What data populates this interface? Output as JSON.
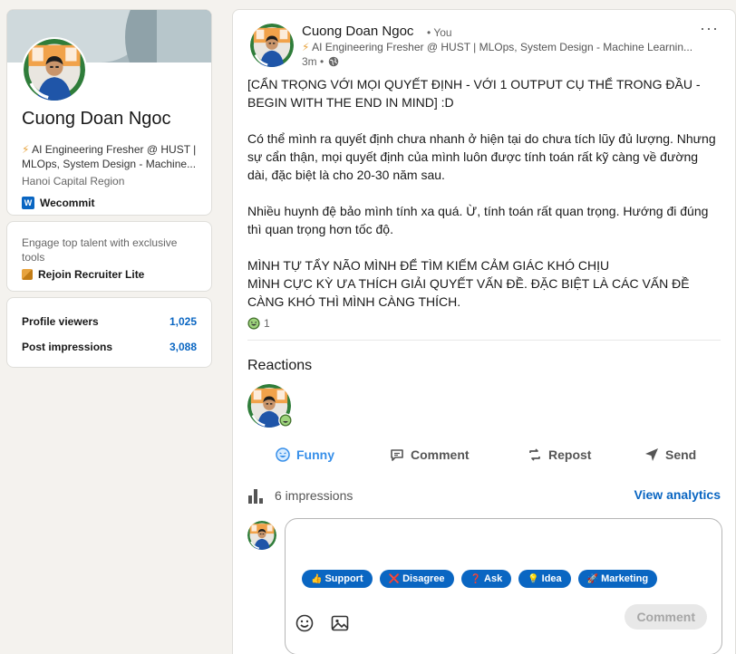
{
  "profile": {
    "name": "Cuong Doan Ngoc",
    "headline_bolt": "⚡",
    "headline": " AI Engineering Fresher @ HUST | MLOps, System Design - Machine...",
    "location": "Hanoi Capital Region",
    "company": "Wecommit",
    "company_logo": "W"
  },
  "premium": {
    "text": "Engage top talent with exclusive tools",
    "link": "Rejoin Recruiter Lite"
  },
  "stats": {
    "viewers_label": "Profile viewers",
    "viewers_value": "1,025",
    "impressions_label": "Post impressions",
    "impressions_value": "3,088"
  },
  "post": {
    "author": "Cuong Doan Ngoc",
    "you_badge": "• You",
    "headline_bolt": "⚡",
    "headline": " AI Engineering Fresher @ HUST | MLOps, System Design - Machine Learnin...",
    "time": "3m •",
    "more": "···",
    "body": [
      "[CẨN TRỌNG VỚI MỌI QUYẾT ĐỊNH - VỚI 1 OUTPUT CỤ THỂ TRONG ĐẦU - BEGIN WITH THE END IN MIND] :D",
      "Có thể mình ra quyết định chưa nhanh ở hiện tại do chưa tích lũy đủ lượng. Nhưng sự cẩn thận, mọi quyết định của mình luôn được tính toán rất kỹ càng về đường dài, đặc biệt là cho 20-30 năm sau.",
      "Nhiều huynh đệ bảo mình tính xa quá. Ừ, tính toán rất quan trọng. Hướng đi đúng thì quan trọng hơn tốc độ.",
      "MÌNH TỰ TẨY NÃO MÌNH ĐỂ TÌM KIẾM CẢM GIÁC KHÓ CHỊU",
      "MÌNH CỰC KỲ ƯA THÍCH GIẢI QUYẾT VẤN ĐỀ. ĐẶC BIỆT LÀ CÁC VẤN ĐỀ CÀNG KHÓ THÌ MÌNH CÀNG THÍCH."
    ],
    "reaction_count": "1",
    "reactions_heading": "Reactions",
    "actions": {
      "funny": "Funny",
      "comment": "Comment",
      "repost": "Repost",
      "send": "Send"
    },
    "impressions": "6 impressions",
    "analytics": "View analytics"
  },
  "comment_box": {
    "chips": [
      {
        "icon": "👍",
        "label": "Support"
      },
      {
        "icon": "❌",
        "label": "Disagree"
      },
      {
        "icon": "❓",
        "label": "Ask"
      },
      {
        "icon": "💡",
        "label": "Idea"
      },
      {
        "icon": "🚀",
        "label": "Marketing"
      }
    ],
    "submit": "Comment"
  },
  "colors": {
    "accent": "#0a66c2",
    "funny": "#378fe9",
    "bolt": "#e7a33e"
  }
}
